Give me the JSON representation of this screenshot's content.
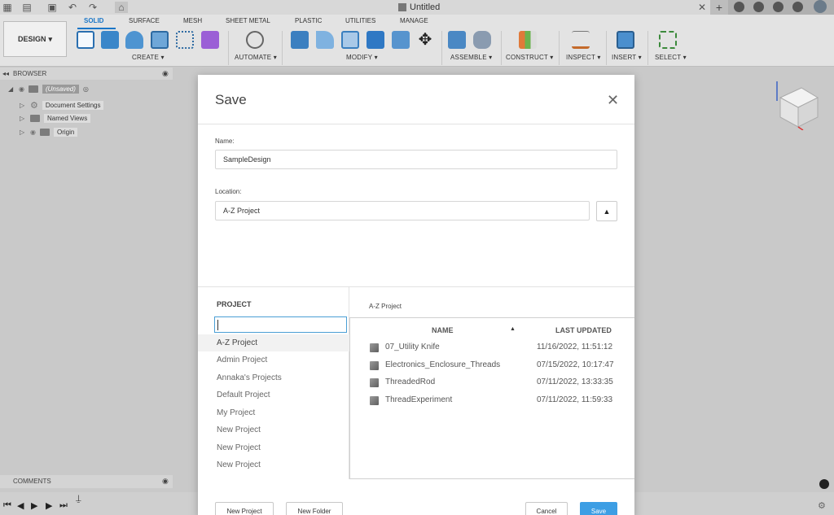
{
  "titlebar": {
    "title": "Untitled"
  },
  "toolbar": {
    "design_label": "DESIGN",
    "tabs": [
      "SOLID",
      "SURFACE",
      "MESH",
      "SHEET METAL",
      "PLASTIC",
      "UTILITIES",
      "MANAGE"
    ],
    "groups": [
      "CREATE",
      "AUTOMATE",
      "MODIFY",
      "ASSEMBLE",
      "CONSTRUCT",
      "INSPECT",
      "INSERT",
      "SELECT"
    ]
  },
  "browser": {
    "header": "BROWSER",
    "items": [
      "(Unsaved)",
      "Document Settings",
      "Named Views",
      "Origin"
    ]
  },
  "comments": {
    "header": "COMMENTS"
  },
  "dialog": {
    "title": "Save",
    "name_label": "Name:",
    "name_value": "SampleDesign",
    "location_label": "Location:",
    "location_value": "A-Z Project",
    "project_header": "PROJECT",
    "projects": [
      "A-Z Project",
      "Admin Project",
      "Annaka's Projects",
      "Default Project",
      "My Project",
      "New Project",
      "New Project",
      "New Project"
    ],
    "file_path": "A-Z Project",
    "columns": {
      "name": "NAME",
      "updated": "LAST UPDATED"
    },
    "files": [
      {
        "name": "07_Utility Knife",
        "updated": "11/16/2022, 11:51:12"
      },
      {
        "name": "Electronics_Enclosure_Threads",
        "updated": "07/15/2022, 10:17:47"
      },
      {
        "name": "ThreadedRod",
        "updated": "07/11/2022, 13:33:35"
      },
      {
        "name": "ThreadExperiment",
        "updated": "07/11/2022, 11:59:33"
      }
    ],
    "buttons": {
      "new_project": "New Project",
      "new_folder": "New Folder",
      "cancel": "Cancel",
      "save": "Save"
    }
  },
  "colors": {
    "accent": "#1a76c7",
    "primary_button": "#3d9ee4"
  }
}
